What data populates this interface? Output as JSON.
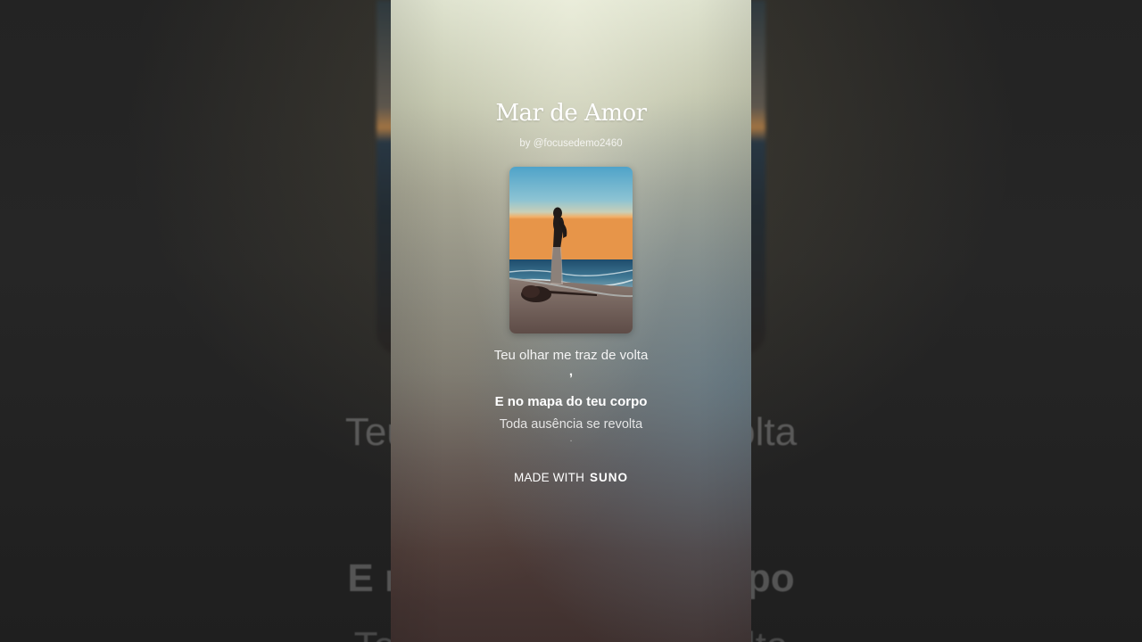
{
  "video": {
    "title": "Mar de Amor",
    "author": "by @focusedemo2460",
    "cover_icon": "beach-sunset-woman-guitar-artwork"
  },
  "lyrics": {
    "previous": "Teu olhar me traz de volta",
    "previous_punct": ",",
    "current": "E no mapa do teu corpo",
    "next": "Toda ausência se revolta",
    "next_punct": "."
  },
  "footer": {
    "made_with": "MADE WITH",
    "brand": "SUNO"
  },
  "background": {
    "lyric_1": "Teu olhar me traz de volta",
    "lyric_2": "E no mapa do teu corpo",
    "lyric_3": "Toda ausência se revolta"
  },
  "colors": {
    "accent_text": "#ffffff",
    "side_background": "#202020"
  }
}
